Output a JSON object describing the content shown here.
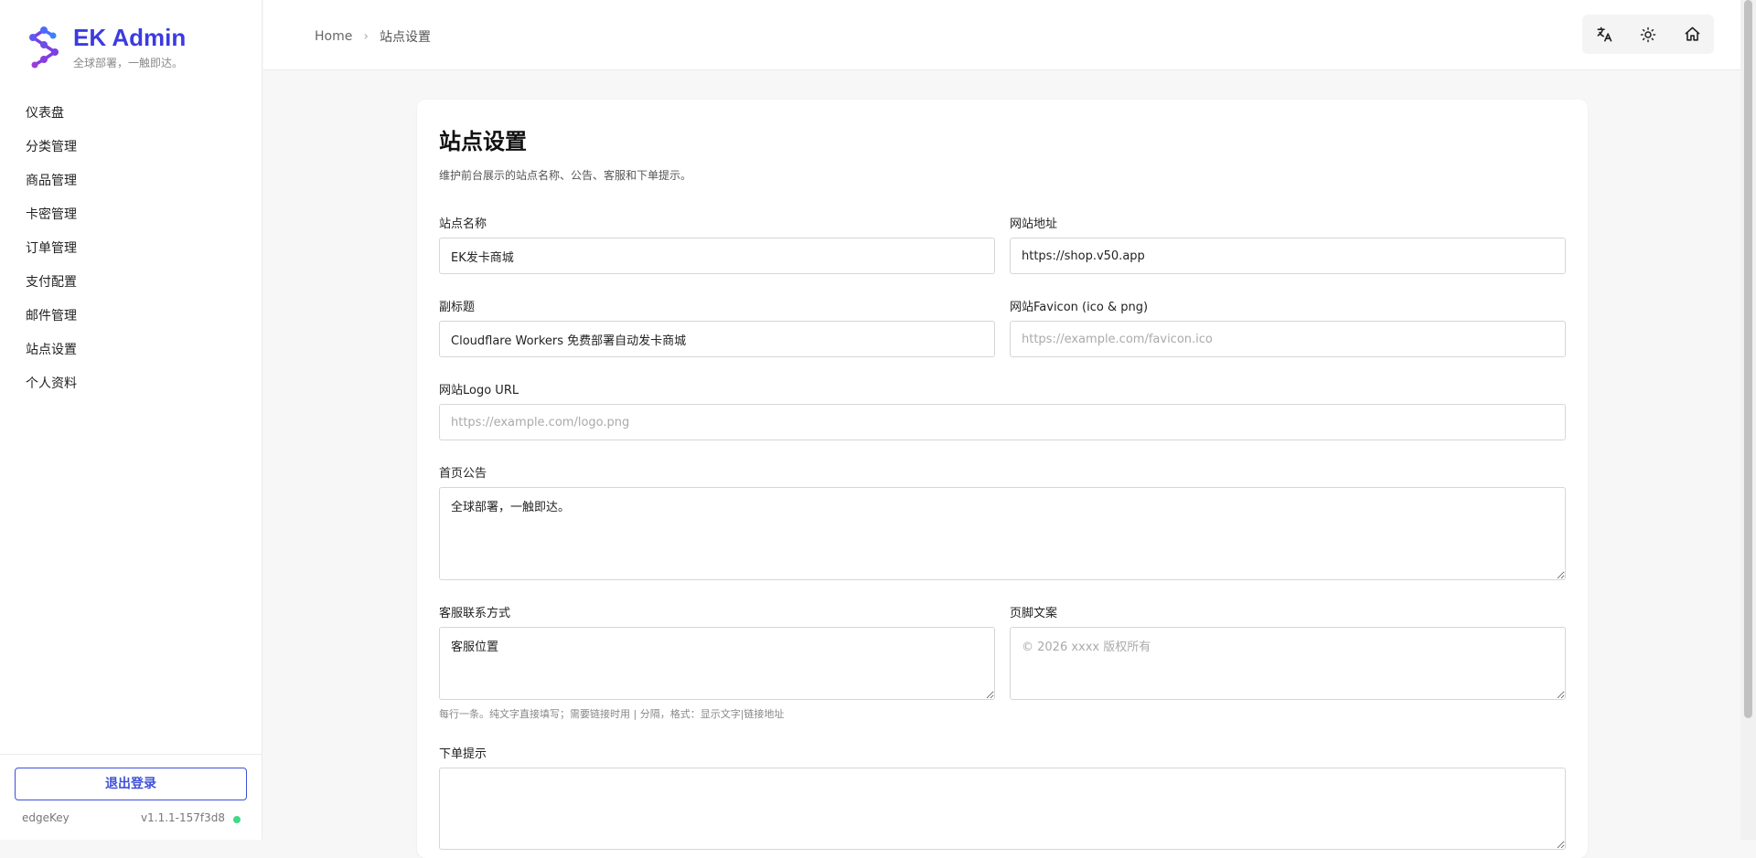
{
  "brand": {
    "name": "EK Admin",
    "tagline": "全球部署，一触即达。",
    "accent": "#3b3be0"
  },
  "sidebar": {
    "items": [
      {
        "label": "仪表盘"
      },
      {
        "label": "分类管理"
      },
      {
        "label": "商品管理"
      },
      {
        "label": "卡密管理"
      },
      {
        "label": "订单管理"
      },
      {
        "label": "支付配置"
      },
      {
        "label": "邮件管理"
      },
      {
        "label": "站点设置"
      },
      {
        "label": "个人资料"
      }
    ],
    "logout_label": "退出登录",
    "footer_name": "edgeKey",
    "version": "v1.1.1-157f3d8",
    "status_color": "#3ddc84"
  },
  "header": {
    "breadcrumb": {
      "home": "Home",
      "current": "站点设置"
    },
    "tools": [
      {
        "icon": "translate-icon"
      },
      {
        "icon": "sun-icon"
      },
      {
        "icon": "home-icon"
      }
    ]
  },
  "page": {
    "title": "站点设置",
    "description": "维护前台展示的站点名称、公告、客服和下单提示。"
  },
  "form": {
    "site_name": {
      "label": "站点名称",
      "value": "EK发卡商城"
    },
    "site_url": {
      "label": "网站地址",
      "value": "https://shop.v50.app"
    },
    "subtitle": {
      "label": "副标题",
      "value": "Cloudflare Workers 免费部署自动发卡商城"
    },
    "favicon": {
      "label": "网站Favicon (ico & png)",
      "placeholder": "https://example.com/favicon.ico"
    },
    "logo": {
      "label": "网站Logo URL",
      "placeholder": "https://example.com/logo.png"
    },
    "announcement": {
      "label": "首页公告",
      "value": "全球部署，一触即达。"
    },
    "contact": {
      "label": "客服联系方式",
      "value": "客服位置",
      "hint": "每行一条。纯文字直接填写；需要链接时用 | 分隔，格式：显示文字|链接地址"
    },
    "footer": {
      "label": "页脚文案",
      "placeholder": "© 2026 xxxx 版权所有"
    },
    "order_tip": {
      "label": "下单提示",
      "value": ""
    }
  }
}
